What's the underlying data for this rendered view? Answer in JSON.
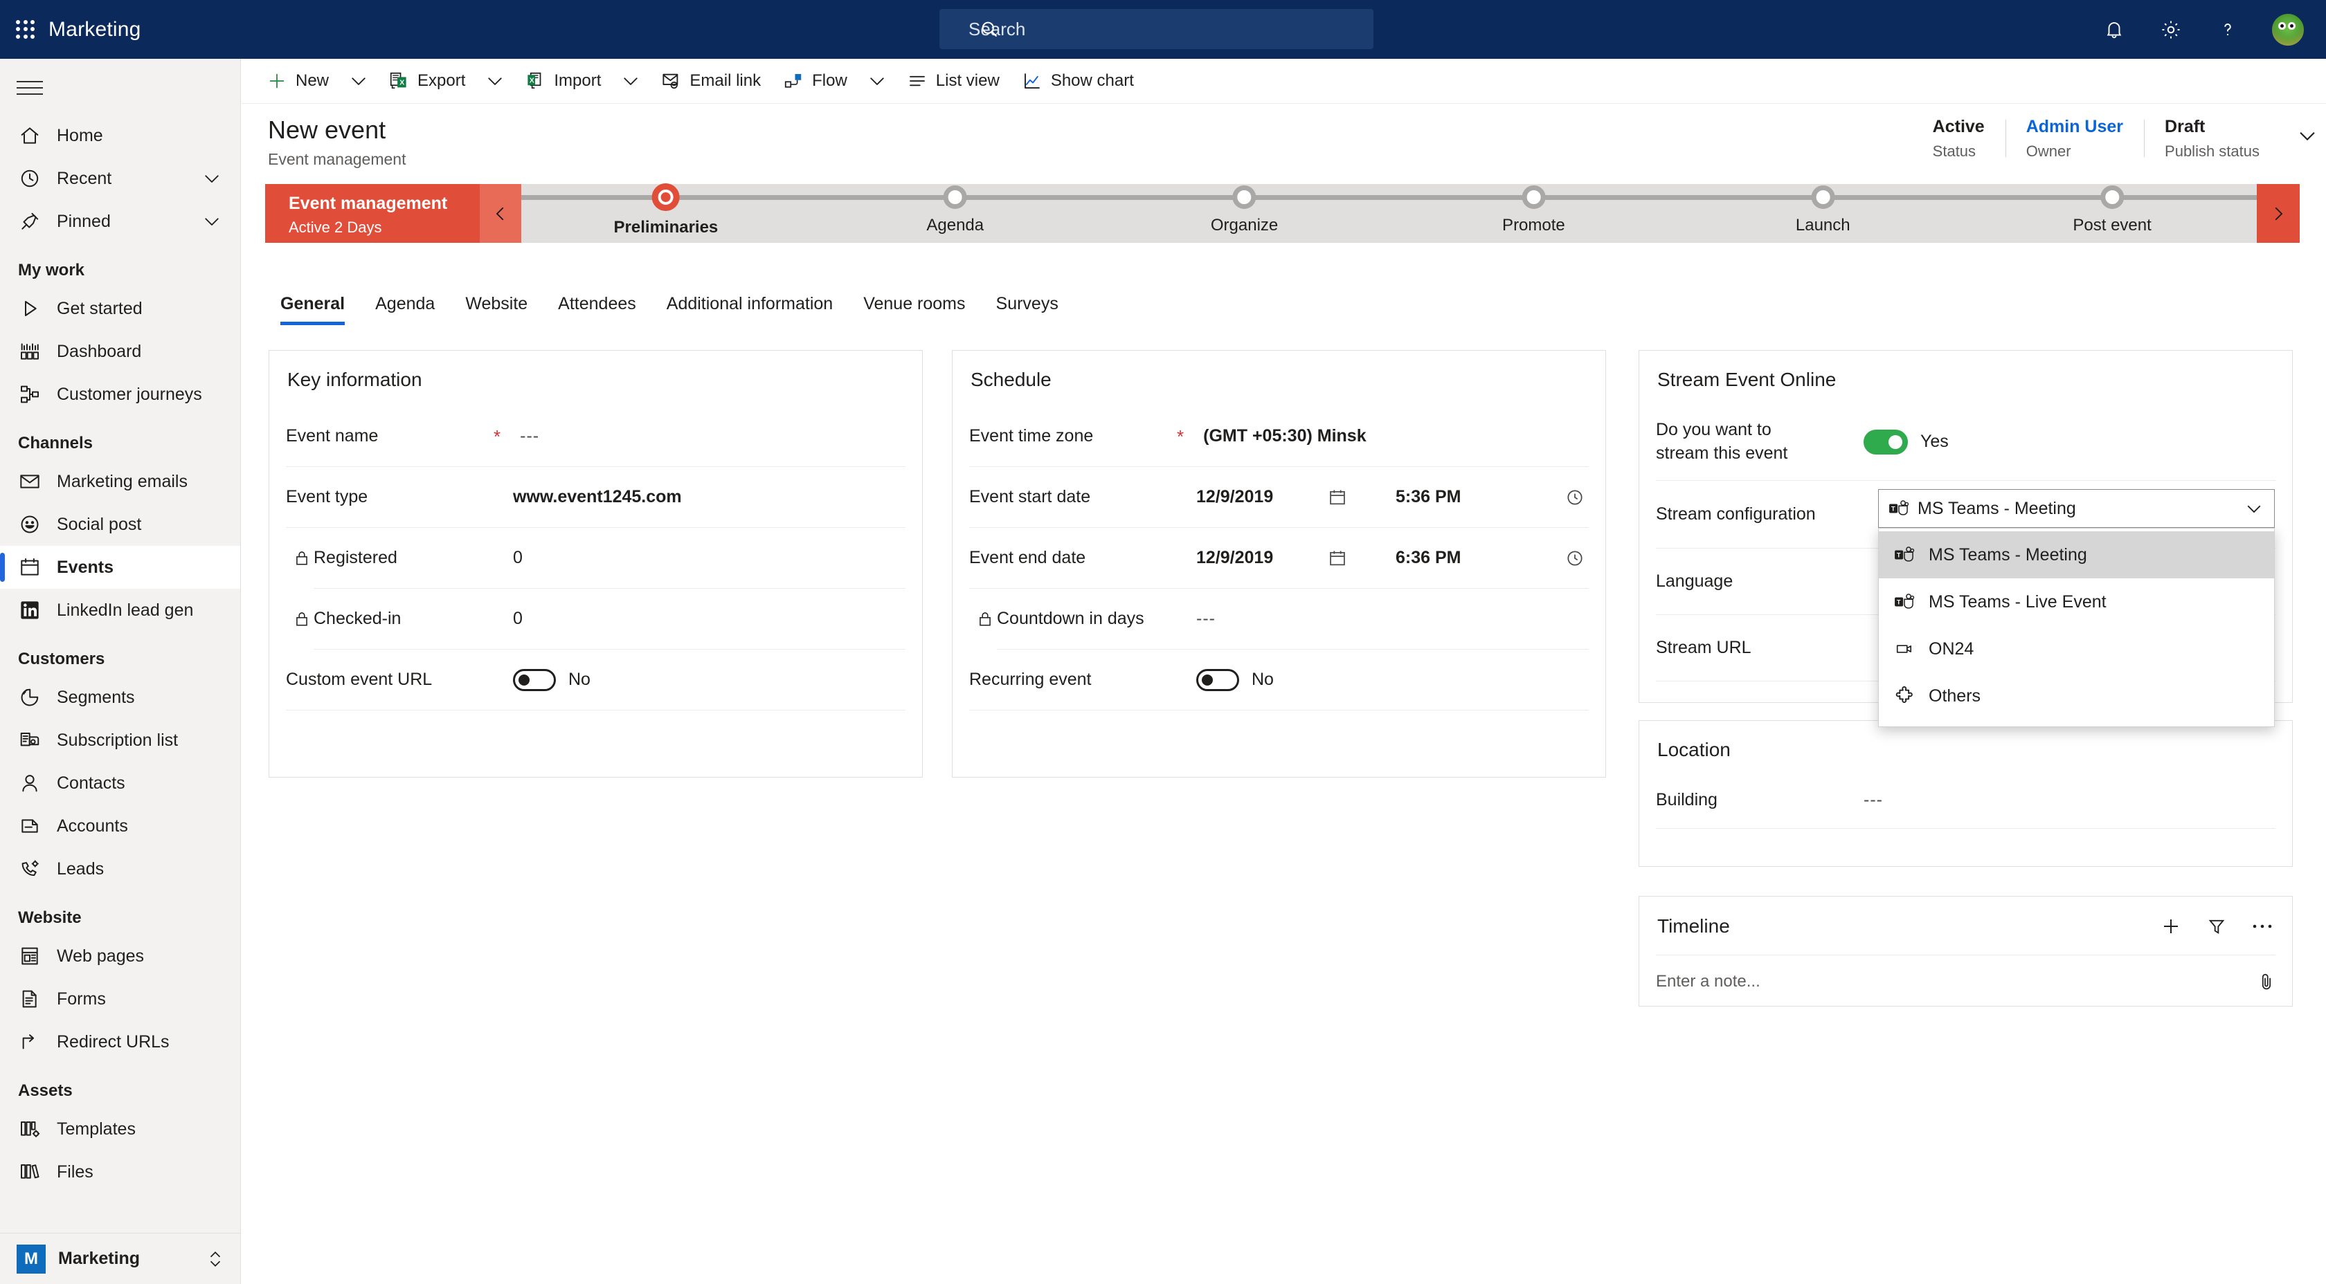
{
  "topbar": {
    "waffle_icon": "app-launcher-icon",
    "app_title": "Marketing",
    "search": {
      "placeholder": "Search",
      "icon": "search-icon"
    },
    "icons": [
      {
        "name": "notifications-icon",
        "glyph": "bell"
      },
      {
        "name": "settings-gear-icon",
        "glyph": "gear"
      },
      {
        "name": "help-icon",
        "glyph": "question"
      }
    ],
    "avatar": "user-avatar"
  },
  "sidebar": {
    "hamburger": "menu-icon",
    "items": [
      {
        "label": "Home",
        "icon": "home-icon",
        "type": "item",
        "selected": false,
        "chevron": false
      },
      {
        "label": "Recent",
        "icon": "clock-icon",
        "type": "item",
        "selected": false,
        "chevron": true
      },
      {
        "label": "Pinned",
        "icon": "pin-icon",
        "type": "item",
        "selected": false,
        "chevron": true
      },
      {
        "label": "My work",
        "type": "group"
      },
      {
        "label": "Get started",
        "icon": "play-icon",
        "type": "item",
        "selected": false,
        "chevron": false
      },
      {
        "label": "Dashboard",
        "icon": "dashboard-icon",
        "type": "item",
        "selected": false,
        "chevron": false
      },
      {
        "label": "Customer journeys",
        "icon": "journey-icon",
        "type": "item",
        "selected": false,
        "chevron": false
      },
      {
        "label": "Channels",
        "type": "group"
      },
      {
        "label": "Marketing emails",
        "icon": "envelope-icon",
        "type": "item",
        "selected": false,
        "chevron": false
      },
      {
        "label": "Social post",
        "icon": "smiley-icon",
        "type": "item",
        "selected": false,
        "chevron": false
      },
      {
        "label": "Events",
        "icon": "calendar-icon",
        "type": "item",
        "selected": true,
        "chevron": false
      },
      {
        "label": "LinkedIn lead gen",
        "icon": "linkedin-icon",
        "type": "item",
        "selected": false,
        "chevron": false
      },
      {
        "label": "Customers",
        "type": "group"
      },
      {
        "label": "Segments",
        "icon": "pie-chart-icon",
        "type": "item",
        "selected": false,
        "chevron": false
      },
      {
        "label": "Subscription list",
        "icon": "subscription-icon",
        "type": "item",
        "selected": false,
        "chevron": false
      },
      {
        "label": "Contacts",
        "icon": "person-icon",
        "type": "item",
        "selected": false,
        "chevron": false
      },
      {
        "label": "Accounts",
        "icon": "account-icon",
        "type": "item",
        "selected": false,
        "chevron": false
      },
      {
        "label": "Leads",
        "icon": "lead-phone-icon",
        "type": "item",
        "selected": false,
        "chevron": false
      },
      {
        "label": "Website",
        "type": "group"
      },
      {
        "label": "Web pages",
        "icon": "web-page-icon",
        "type": "item",
        "selected": false,
        "chevron": false
      },
      {
        "label": "Forms",
        "icon": "form-icon",
        "type": "item",
        "selected": false,
        "chevron": false
      },
      {
        "label": "Redirect URLs",
        "icon": "redirect-icon",
        "type": "item",
        "selected": false,
        "chevron": false
      },
      {
        "label": "Assets",
        "type": "group"
      },
      {
        "label": "Templates",
        "icon": "templates-icon",
        "type": "item",
        "selected": false,
        "chevron": false
      },
      {
        "label": "Files",
        "icon": "files-icon",
        "type": "item",
        "selected": false,
        "chevron": false
      }
    ],
    "footer": {
      "badge": "M",
      "app_name": "Marketing",
      "switch_icon": "app-switcher-icon"
    }
  },
  "commandbar": {
    "items": [
      {
        "label": "New",
        "icon": "plus-icon",
        "caret": true
      },
      {
        "label": "Export",
        "icon": "excel-export-icon",
        "caret": true
      },
      {
        "label": "Import",
        "icon": "excel-import-icon",
        "caret": true
      },
      {
        "label": "Email link",
        "icon": "email-link-icon",
        "caret": false
      },
      {
        "label": "Flow",
        "icon": "flow-icon",
        "caret": true
      },
      {
        "label": "List view",
        "icon": "list-view-icon",
        "caret": false
      },
      {
        "label": "Show chart",
        "icon": "chart-icon",
        "caret": false
      }
    ]
  },
  "header": {
    "title": "New event",
    "subtitle": "Event management",
    "fields": [
      {
        "value": "Active",
        "label": "Status",
        "link": false
      },
      {
        "value": "Admin User",
        "label": "Owner",
        "link": true
      },
      {
        "value": "Draft",
        "label": "Publish status",
        "link": false
      }
    ],
    "expand_icon": "chevron-down-icon"
  },
  "bpf": {
    "name": "Event management",
    "subtitle": "Active 2 Days",
    "prev_icon": "chevron-left-icon",
    "next_icon": "chevron-right-icon",
    "stages": [
      {
        "label": "Preliminaries",
        "active": true
      },
      {
        "label": "Agenda",
        "active": false
      },
      {
        "label": "Organize",
        "active": false
      },
      {
        "label": "Promote",
        "active": false
      },
      {
        "label": "Launch",
        "active": false
      },
      {
        "label": "Post event",
        "active": false
      }
    ]
  },
  "tabs": [
    {
      "label": "General",
      "active": true
    },
    {
      "label": "Agenda",
      "active": false
    },
    {
      "label": "Website",
      "active": false
    },
    {
      "label": "Attendees",
      "active": false
    },
    {
      "label": "Additional information",
      "active": false
    },
    {
      "label": "Venue rooms",
      "active": false
    },
    {
      "label": "Surveys",
      "active": false
    }
  ],
  "key_information": {
    "title": "Key information",
    "rows": [
      {
        "label": "Event name",
        "required": true,
        "locked": false,
        "value": "---",
        "kind": "text",
        "muted": true
      },
      {
        "label": "Event type",
        "required": false,
        "locked": false,
        "value": "www.event1245.com",
        "kind": "text",
        "bold": true
      },
      {
        "label": "Registered",
        "required": false,
        "locked": true,
        "value": "0",
        "kind": "text"
      },
      {
        "label": "Checked-in",
        "required": false,
        "locked": true,
        "value": "0",
        "kind": "text"
      },
      {
        "label": "Custom event URL",
        "required": false,
        "locked": false,
        "value": "No",
        "kind": "toggle",
        "on": false
      }
    ]
  },
  "schedule": {
    "title": "Schedule",
    "rows": [
      {
        "label": "Event time zone",
        "required": true,
        "locked": false,
        "value": "(GMT +05:30) Minsk",
        "kind": "text",
        "bold": true
      },
      {
        "label": "Event start date",
        "required": false,
        "locked": false,
        "date": "12/9/2019",
        "time": "5:36 PM",
        "kind": "datetime"
      },
      {
        "label": "Event end date",
        "required": false,
        "locked": false,
        "date": "12/9/2019",
        "time": "6:36 PM",
        "kind": "datetime"
      },
      {
        "label": "Countdown in days",
        "required": false,
        "locked": true,
        "value": "---",
        "kind": "text",
        "muted": true
      },
      {
        "label": "Recurring event",
        "required": false,
        "locked": false,
        "value": "No",
        "kind": "toggle",
        "on": false
      }
    ]
  },
  "stream": {
    "title": "Stream Event Online",
    "rows": [
      {
        "label": "Do you want to\nstream this event",
        "value": "Yes",
        "kind": "toggle",
        "on": true
      },
      {
        "label": "Stream configuration",
        "kind": "dropdown"
      },
      {
        "label": "Language",
        "kind": "blank"
      },
      {
        "label": "Stream URL",
        "kind": "blank"
      }
    ],
    "dropdown": {
      "selected": "MS Teams - Meeting",
      "selected_icon": "ms-teams-icon",
      "chevron": "chevron-down-icon",
      "options": [
        {
          "label": "MS Teams - Meeting",
          "icon": "ms-teams-icon",
          "highlighted": true
        },
        {
          "label": "MS Teams - Live Event",
          "icon": "ms-teams-icon",
          "highlighted": false
        },
        {
          "label": "ON24",
          "icon": "video-camera-icon",
          "highlighted": false
        },
        {
          "label": "Others",
          "icon": "puzzle-icon",
          "highlighted": false
        }
      ]
    }
  },
  "location": {
    "title": "Location",
    "rows": [
      {
        "label": "Building",
        "value": "---"
      }
    ]
  },
  "timeline": {
    "title": "Timeline",
    "actions": [
      {
        "name": "add-timeline-record-button",
        "icon": "plus-icon"
      },
      {
        "name": "filter-timeline-button",
        "icon": "filter-icon"
      },
      {
        "name": "timeline-more-commands-button",
        "icon": "ellipsis-icon"
      }
    ],
    "note_placeholder": "Enter a note...",
    "attach_icon": "paperclip-icon"
  },
  "colors": {
    "topbar": "#0b2a5b",
    "accent_blue": "#1264d8",
    "bpf_red": "#e04e39",
    "toggle_green": "#2faa4c",
    "required_red": "#d13438",
    "sidebar_bg": "#f3f2f1"
  }
}
